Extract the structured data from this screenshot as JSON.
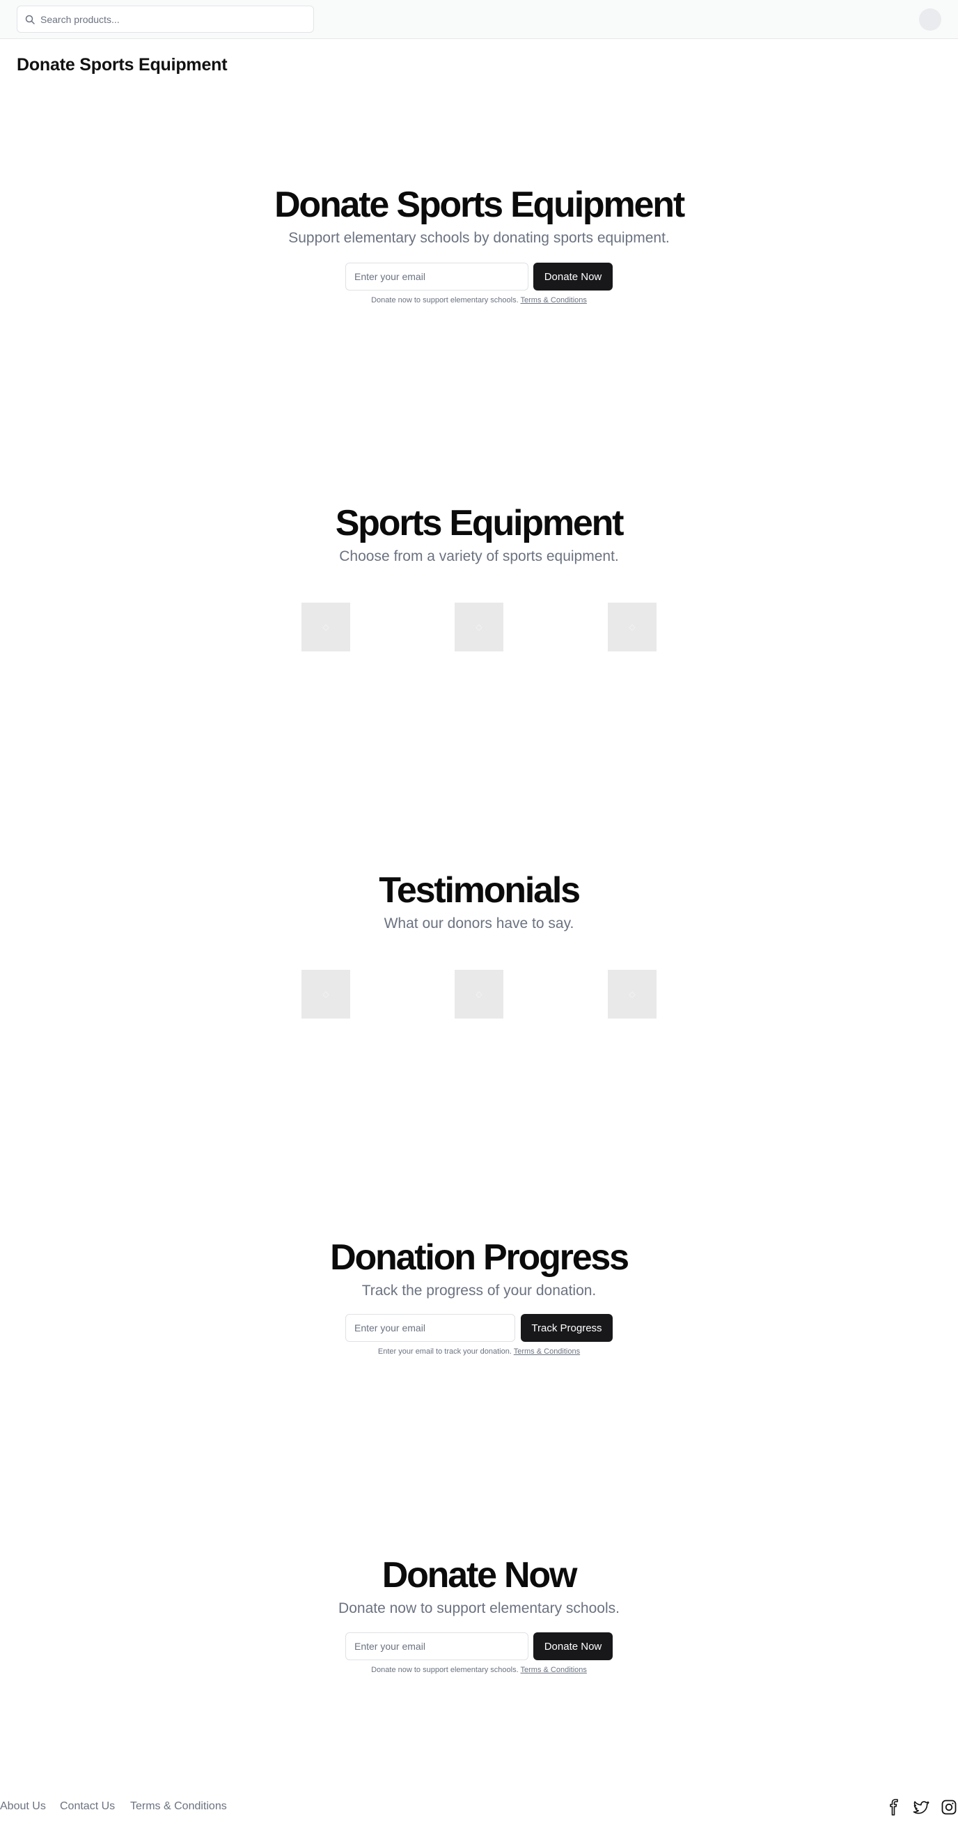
{
  "header": {
    "search_placeholder": "Search products...",
    "brand": "Donate Sports Equipment"
  },
  "hero": {
    "title": "Donate Sports Equipment",
    "subtitle": "Support elementary schools by donating sports equipment.",
    "email_placeholder": "Enter your email",
    "button": "Donate Now",
    "note": "Donate now to support elementary schools.",
    "terms": "Terms & Conditions"
  },
  "equipment": {
    "title": "Sports Equipment",
    "subtitle": "Choose from a variety of sports equipment.",
    "images": [
      "image-placeholder-icon",
      "image-placeholder-icon",
      "image-placeholder-icon"
    ]
  },
  "testimonials": {
    "title": "Testimonials",
    "subtitle": "What our donors have to say.",
    "images": [
      "image-placeholder-icon",
      "image-placeholder-icon",
      "image-placeholder-icon"
    ]
  },
  "progress": {
    "title": "Donation Progress",
    "subtitle": "Track the progress of your donation.",
    "email_placeholder": "Enter your email",
    "button": "Track Progress",
    "note": "Enter your email to track your donation.",
    "terms": "Terms & Conditions"
  },
  "donate": {
    "title": "Donate Now",
    "subtitle": "Donate now to support elementary schools.",
    "email_placeholder": "Enter your email",
    "button": "Donate Now",
    "note": "Donate now to support elementary schools.",
    "terms": "Terms & Conditions"
  },
  "footer": {
    "links": [
      "About Us",
      "Contact Us",
      "Terms & Conditions"
    ],
    "social": [
      "facebook-icon",
      "twitter-icon",
      "instagram-icon"
    ]
  },
  "colors": {
    "button_bg": "#18181b",
    "muted_text": "#6b7280",
    "placeholder_bg": "#e9e9e9"
  }
}
